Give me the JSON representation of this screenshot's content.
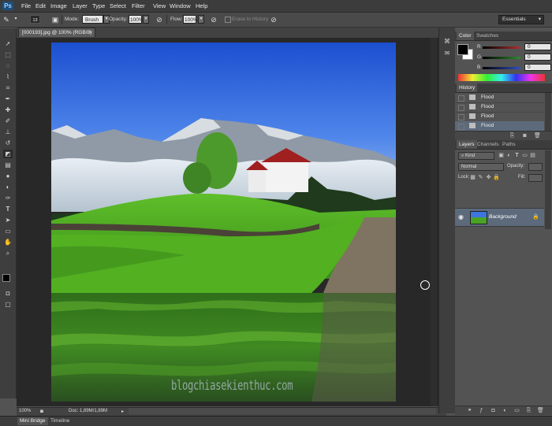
{
  "app": {
    "logo": "Ps"
  },
  "menu": [
    "File",
    "Edit",
    "Image",
    "Layer",
    "Type",
    "Select",
    "Filter",
    "View",
    "Window",
    "Help"
  ],
  "options_bar": {
    "brush_size": "13",
    "mode_label": "Mode:",
    "mode_value": "Brush",
    "opacity_label": "Opacity:",
    "opacity_value": "100%",
    "flow_label": "Flow:",
    "flow_value": "100%",
    "erase_to_history": "Erase to History",
    "workspace": "Essentials"
  },
  "document": {
    "tab_title": "[000193].jpg @ 100% (RGB/8) *",
    "watermark": "blogchiasekienthuc.com",
    "zoom": "100%",
    "doc_info": "Doc: 1,89M/1,89M"
  },
  "bottom_tabs": [
    "Mini Bridge",
    "Timeline"
  ],
  "color_panel": {
    "tabs": [
      "Color",
      "Swatches"
    ],
    "channels": [
      {
        "label": "R",
        "value": "0",
        "color": "#b03030"
      },
      {
        "label": "G",
        "value": "0",
        "color": "#2e8b2e"
      },
      {
        "label": "B",
        "value": "0",
        "color": "#3050c0"
      }
    ],
    "foreground": "#000000",
    "background": "#ffffff"
  },
  "history_panel": {
    "tab": "History",
    "items": [
      "Flood",
      "Flood",
      "Flood",
      "Flood"
    ],
    "selected_index": 3
  },
  "layers_panel": {
    "tabs": [
      "Layers",
      "Channels",
      "Paths"
    ],
    "kind_label": "Kind",
    "blend_mode": "Normal",
    "opacity_label": "Opacity:",
    "lock_label": "Lock:",
    "fill_label": "Fill:",
    "layer_name": "Background"
  }
}
